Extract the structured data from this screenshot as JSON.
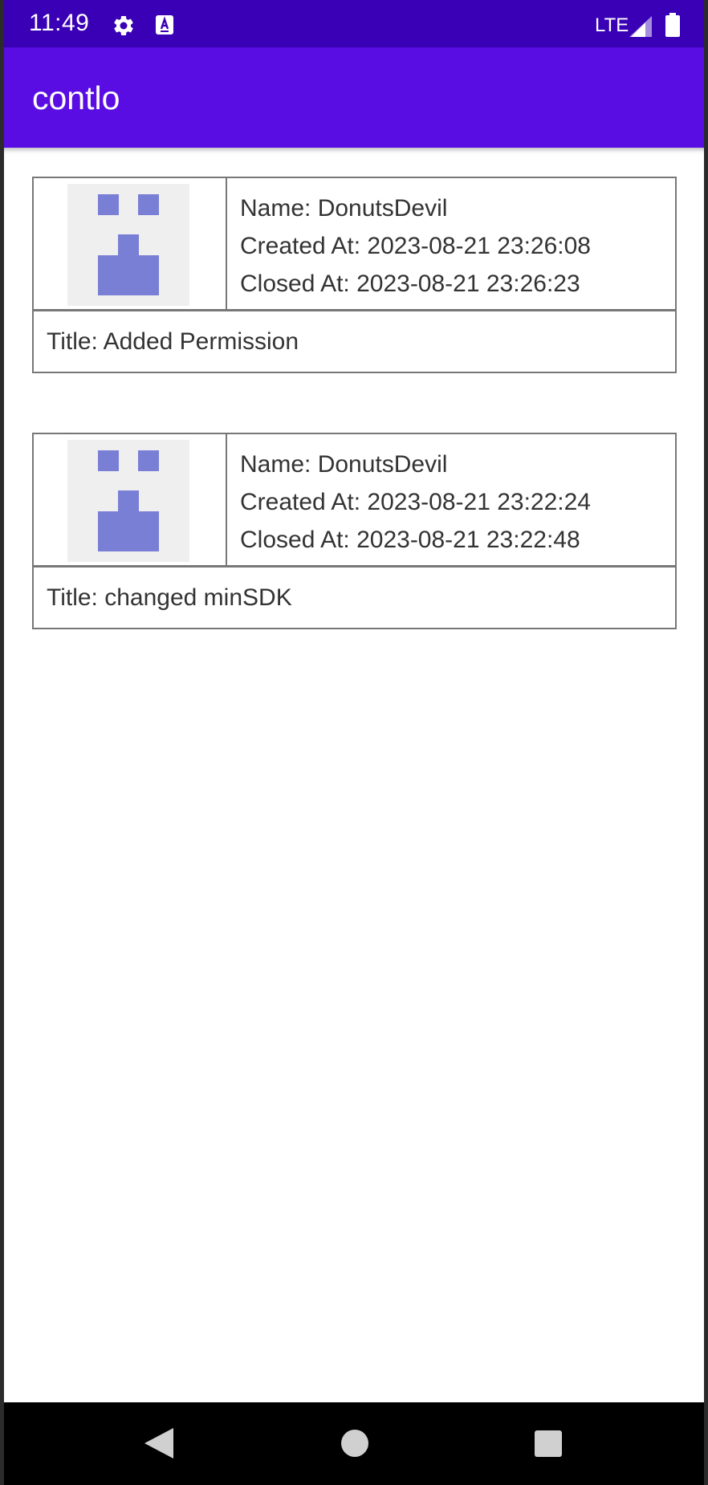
{
  "status_bar": {
    "time": "11:49",
    "network": "LTE",
    "icons": [
      "settings-icon",
      "keyboard-a-icon",
      "signal-icon",
      "battery-icon"
    ]
  },
  "app_bar": {
    "title": "contlo"
  },
  "cards": [
    {
      "name": "Name: DonutsDevil",
      "created_at": "Created At: 2023-08-21 23:26:08",
      "closed_at": "Closed At: 2023-08-21 23:26:23",
      "title": "Title: Added Permission"
    },
    {
      "name": "Name: DonutsDevil",
      "created_at": "Created At: 2023-08-21 23:22:24",
      "closed_at": "Closed At: 2023-08-21 23:22:48",
      "title": "Title: changed minSDK"
    }
  ],
  "nav_bar": {
    "icons": [
      "back-icon",
      "home-icon",
      "recents-icon"
    ]
  },
  "colors": {
    "status_bar": "#3a00b5",
    "app_bar": "#5a0de3",
    "avatar_pixels": "#7a7fd6",
    "avatar_bg": "#efefef"
  }
}
